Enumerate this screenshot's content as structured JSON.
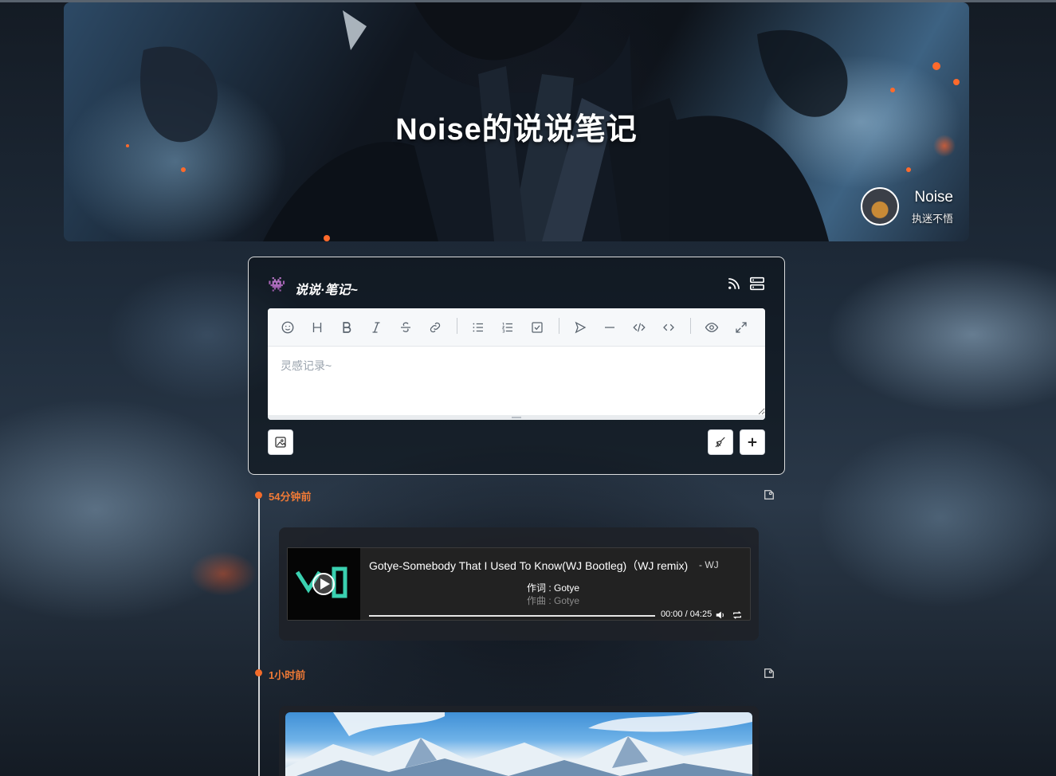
{
  "banner": {
    "title": "Noise的说说笔记",
    "author_name": "Noise",
    "author_motto": "执迷不悟"
  },
  "composer": {
    "title": "说说·笔记~",
    "placeholder": "灵感记录~",
    "toolbar": [
      "emoji",
      "heading",
      "bold",
      "italic",
      "strike",
      "link",
      "unordered-list",
      "ordered-list",
      "check",
      "send",
      "line",
      "code-block",
      "inline-code",
      "preview",
      "fullscreen"
    ]
  },
  "timeline": [
    {
      "time": "54分钟前",
      "music": {
        "title": "Gotye-Somebody That I Used To Know(WJ Bootleg)（WJ remix)",
        "author": "- WJ",
        "lyric_line1": "作词 : Gotye",
        "lyric_line2": "作曲 : Gotye",
        "time": "00:00 / 04:25"
      }
    },
    {
      "time": "1小时前"
    }
  ],
  "colors": {
    "accent": "#f26b2a",
    "time_text": "#f07a36",
    "card_bg": "#1e2228"
  }
}
